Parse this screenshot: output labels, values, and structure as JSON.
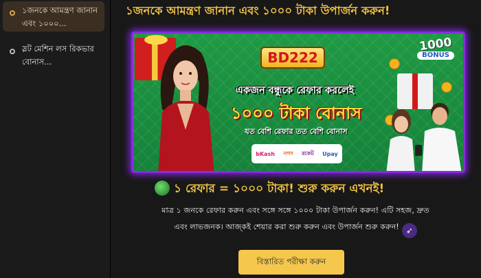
{
  "sidebar": {
    "items": [
      {
        "label": "১জনকে আমন্ত্রণ জানান এবং ১০০০...",
        "active": true
      },
      {
        "label": "স্লট মেশিন লস রিকভার বোনাস...",
        "active": false
      }
    ]
  },
  "main": {
    "title": "১জনকে আমন্ত্রণ জানান এবং ১০০০ টাকা উপার্জন করুন!",
    "banner": {
      "brand": "BD222",
      "headline1": "একজন বন্ধুকে রেফার করলেই",
      "headline2": "১০০০ টাকা বোনাস",
      "headline3": "যত বেশি রেফার তত বেশি বোনাস",
      "bonus_number": "1000",
      "bonus_word": "BONUS",
      "payments": [
        "bKash",
        "নগদ",
        "রকেট",
        "Upay"
      ]
    },
    "promo": "১ রেফার = ১০০০ টাকা! শুরু করুন এখনই!",
    "desc_line1": "মাত্র ১ জনকে রেফার করুন এবং সঙ্গে সঙ্গে ১০০০ টাকা উপার্জন করুন! এটি সহজ, দ্রুত",
    "desc_line2": "এবং লাভজনক। আজ্কই শেয়ার করা শুরু করুন এবং উপার্জন শুরু করুন!",
    "details_button": "বিস্তারিত পরীক্ষা করুন"
  },
  "colors": {
    "accent": "#f3c245",
    "banner_green": "#1f9a44",
    "banner_border": "#8a2be2",
    "active_item_bg": "#3a2f22"
  }
}
